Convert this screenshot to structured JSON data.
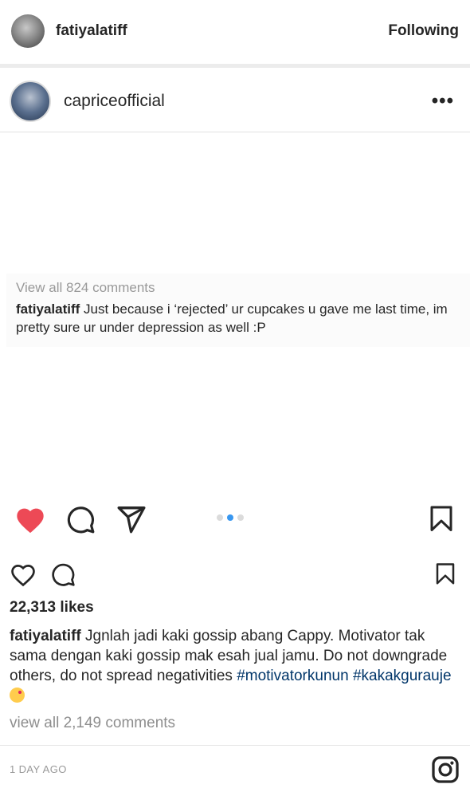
{
  "header": {
    "username": "fatiyalatiff",
    "follow_label": "Following"
  },
  "embedded_post": {
    "username": "capriceofficial",
    "more_label": "•••",
    "view_comments": "View all 824 comments",
    "comment_user": "fatiyalatiff",
    "comment_text": "Just because i ‘rejected’ ur cupcakes u gave me last time, im pretty sure ur under depression as well :P",
    "carousel": {
      "count": 3,
      "active_index": 1
    }
  },
  "post": {
    "likes": "22,313 likes",
    "caption_user": "fatiyalatiff",
    "caption_text": "Jgnlah jadi kaki gossip abang Cappy. Motivator tak sama dengan kaki gossip mak esah jual jamu. Do not downgrade others, do not spread negativities",
    "hashtags": [
      "#motivatorkunun",
      "#kakakgurauje"
    ],
    "view_comments": "view all 2,149 comments",
    "timestamp": "1 DAY AGO"
  },
  "icons": {
    "like_filled_color": "#ed4956",
    "accent": "#3897f0",
    "hashtag_color": "#003569"
  }
}
